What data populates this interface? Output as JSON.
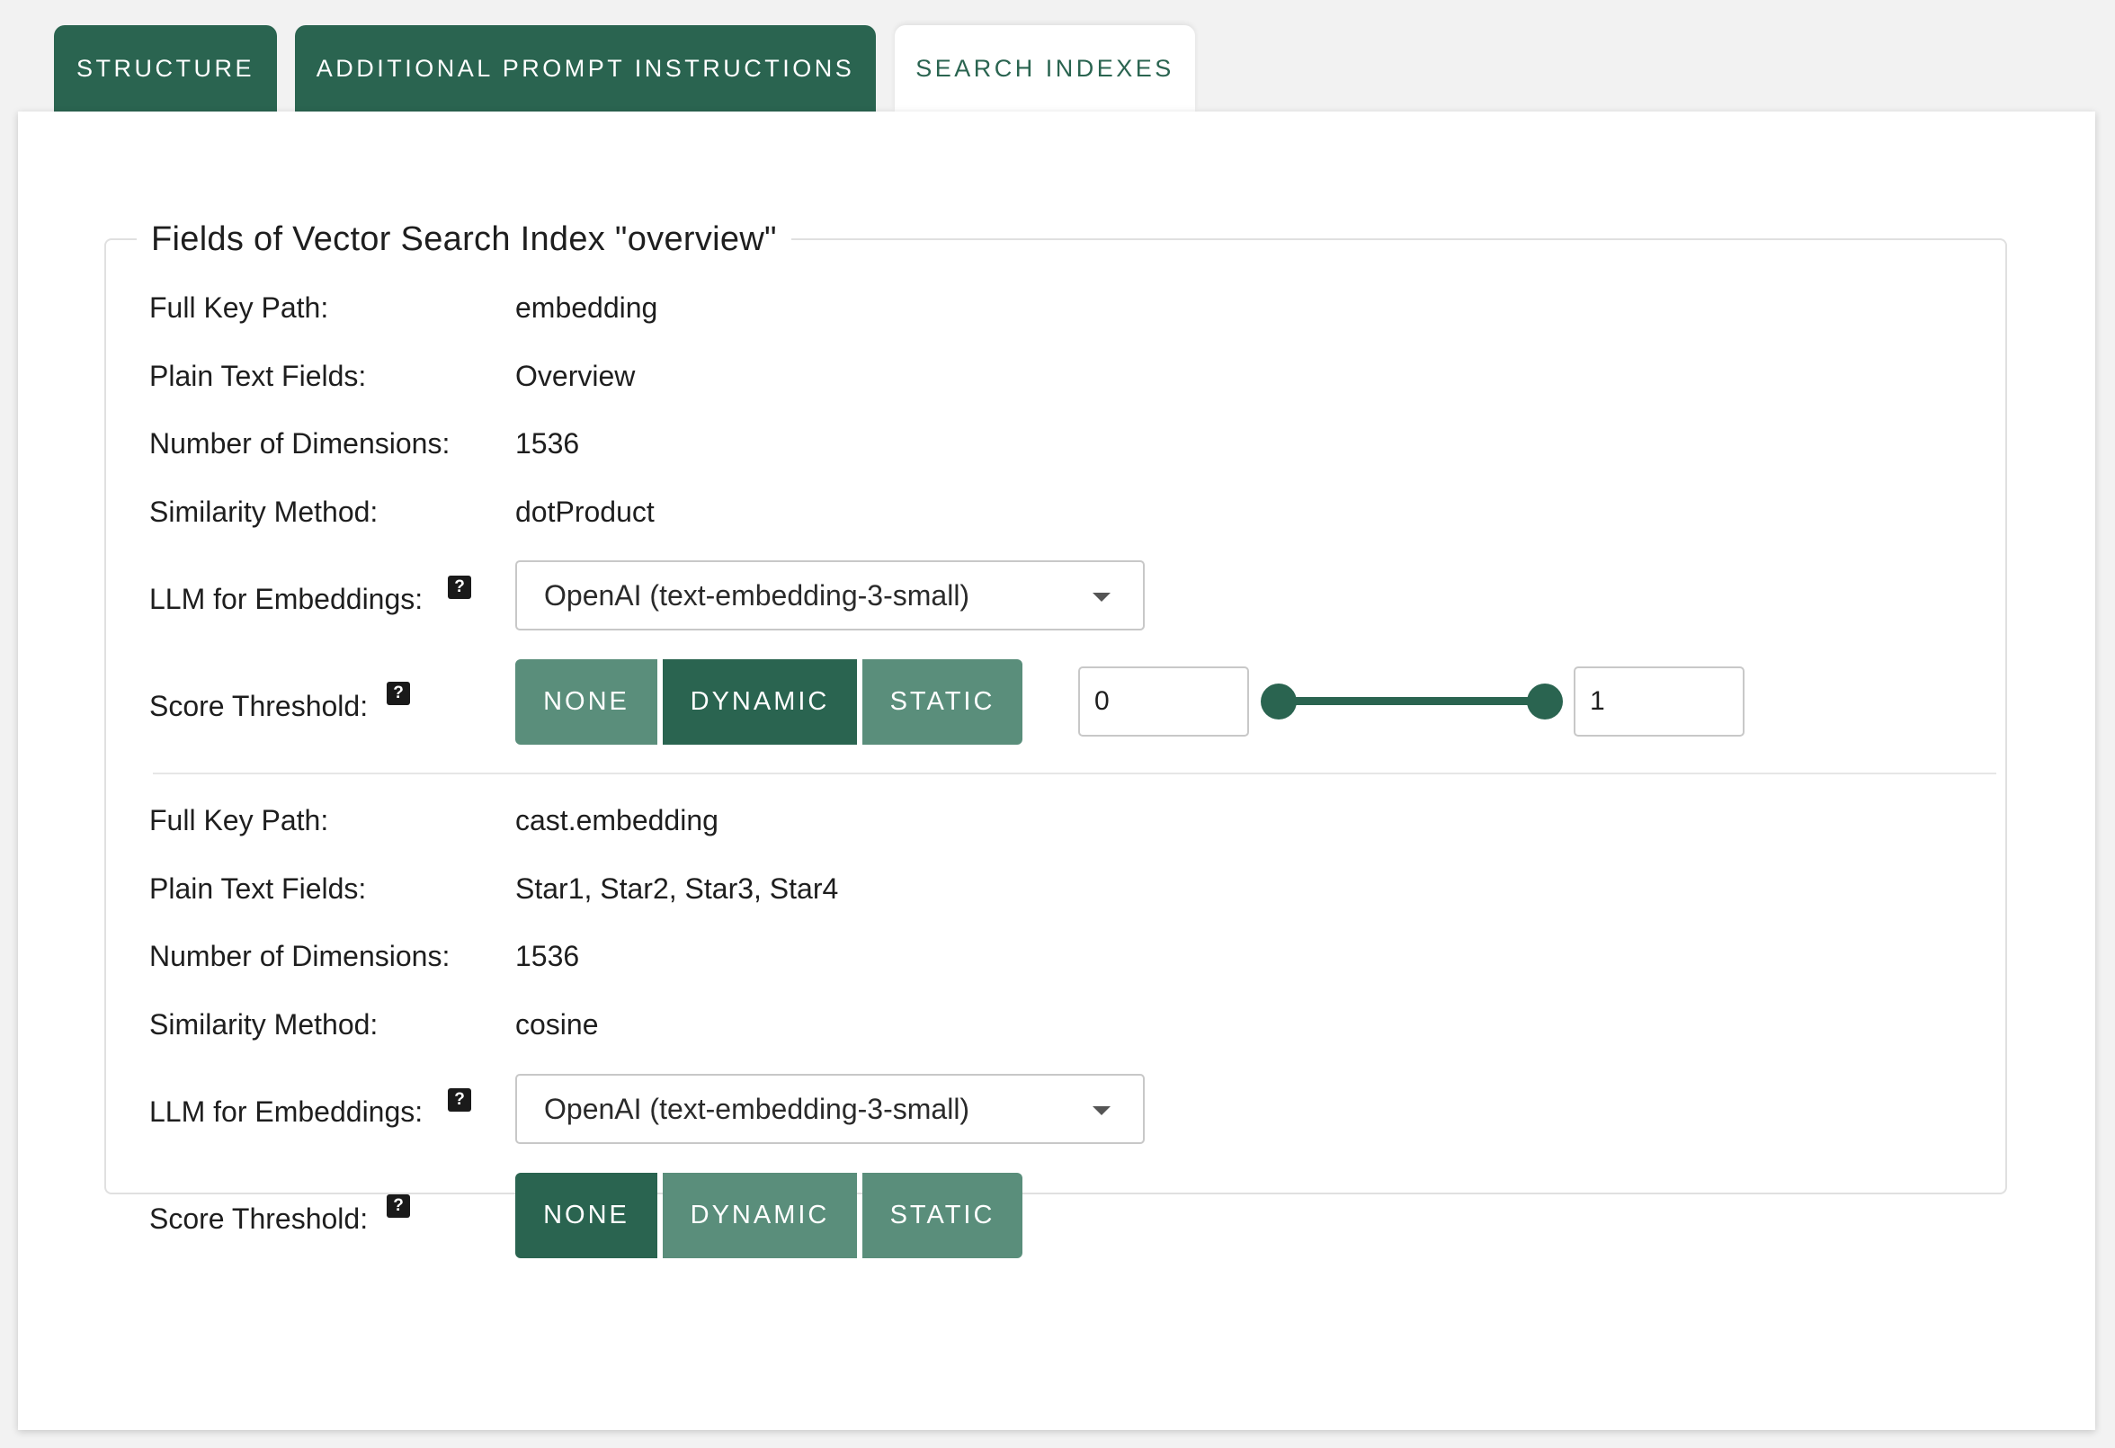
{
  "tabs": [
    {
      "label": "STRUCTURE"
    },
    {
      "label": "ADDITIONAL PROMPT INSTRUCTIONS"
    },
    {
      "label": "SEARCH INDEXES",
      "active": true
    }
  ],
  "index": {
    "legend": "Fields of Vector Search Index \"overview\"",
    "fields": [
      {
        "full_key_path_label": "Full Key Path:",
        "full_key_path": "embedding",
        "plain_text_label": "Plain Text Fields:",
        "plain_text": "Overview",
        "dimensions_label": "Number of Dimensions:",
        "dimensions": "1536",
        "similarity_label": "Similarity Method:",
        "similarity": "dotProduct",
        "llm_label": "LLM for Embeddings:",
        "llm_help": "?",
        "llm_value": "OpenAI (text-embedding-3-small)",
        "threshold_label": "Score Threshold:",
        "threshold_help": "?",
        "threshold_options": [
          "NONE",
          "DYNAMIC",
          "STATIC"
        ],
        "threshold_selected": "DYNAMIC",
        "range_min": "0",
        "range_max": "1"
      },
      {
        "full_key_path_label": "Full Key Path:",
        "full_key_path": "cast.embedding",
        "plain_text_label": "Plain Text Fields:",
        "plain_text": "Star1, Star2, Star3, Star4",
        "dimensions_label": "Number of Dimensions:",
        "dimensions": "1536",
        "similarity_label": "Similarity Method:",
        "similarity": "cosine",
        "llm_label": "LLM for Embeddings:",
        "llm_help": "?",
        "llm_value": "OpenAI (text-embedding-3-small)",
        "threshold_label": "Score Threshold:",
        "threshold_help": "?",
        "threshold_options": [
          "NONE",
          "DYNAMIC",
          "STATIC"
        ],
        "threshold_selected": "NONE"
      }
    ]
  },
  "colors": {
    "accent": "#2a6450",
    "accent_muted": "#5a8e7b",
    "panel": "#ffffff",
    "background": "#f2f2f2"
  }
}
